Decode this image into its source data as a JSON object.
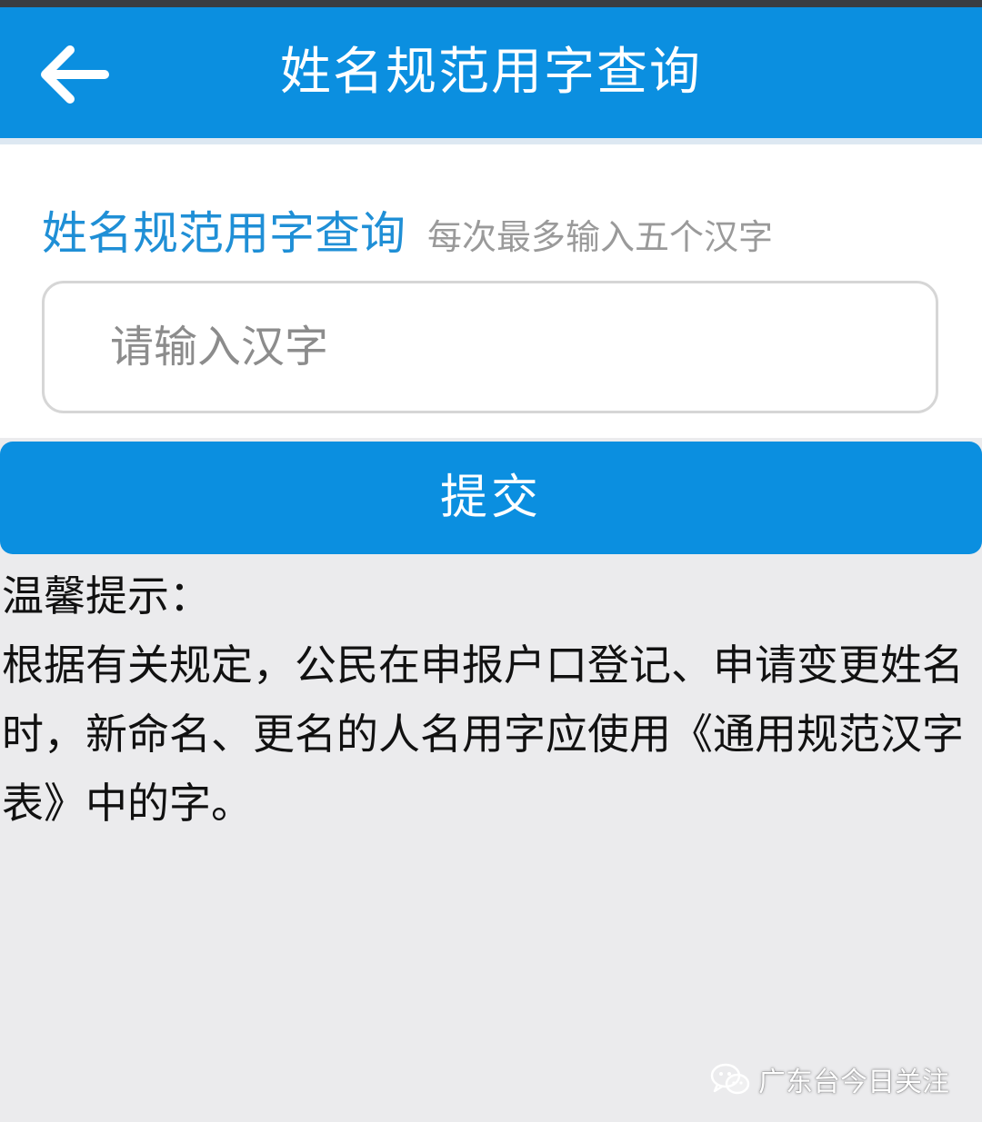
{
  "header": {
    "title": "姓名规范用字查询",
    "back_icon": "arrow-left-icon"
  },
  "form": {
    "title": "姓名规范用字查询",
    "hint": "每次最多输入五个汉字",
    "input_placeholder": "请输入汉字",
    "input_value": ""
  },
  "submit": {
    "label": "提交"
  },
  "notice": {
    "title": "温馨提示：",
    "body": "根据有关规定，公民在申报户口登记、申请变更姓名时，新命名、更名的人名用字应使用《通用规范汉字表》中的字。"
  },
  "watermark": {
    "text": "广东台今日关注",
    "icon": "wechat-icon"
  },
  "colors": {
    "primary": "#0b8fe0",
    "title_blue": "#1f8fd6",
    "background": "#ebebed"
  }
}
